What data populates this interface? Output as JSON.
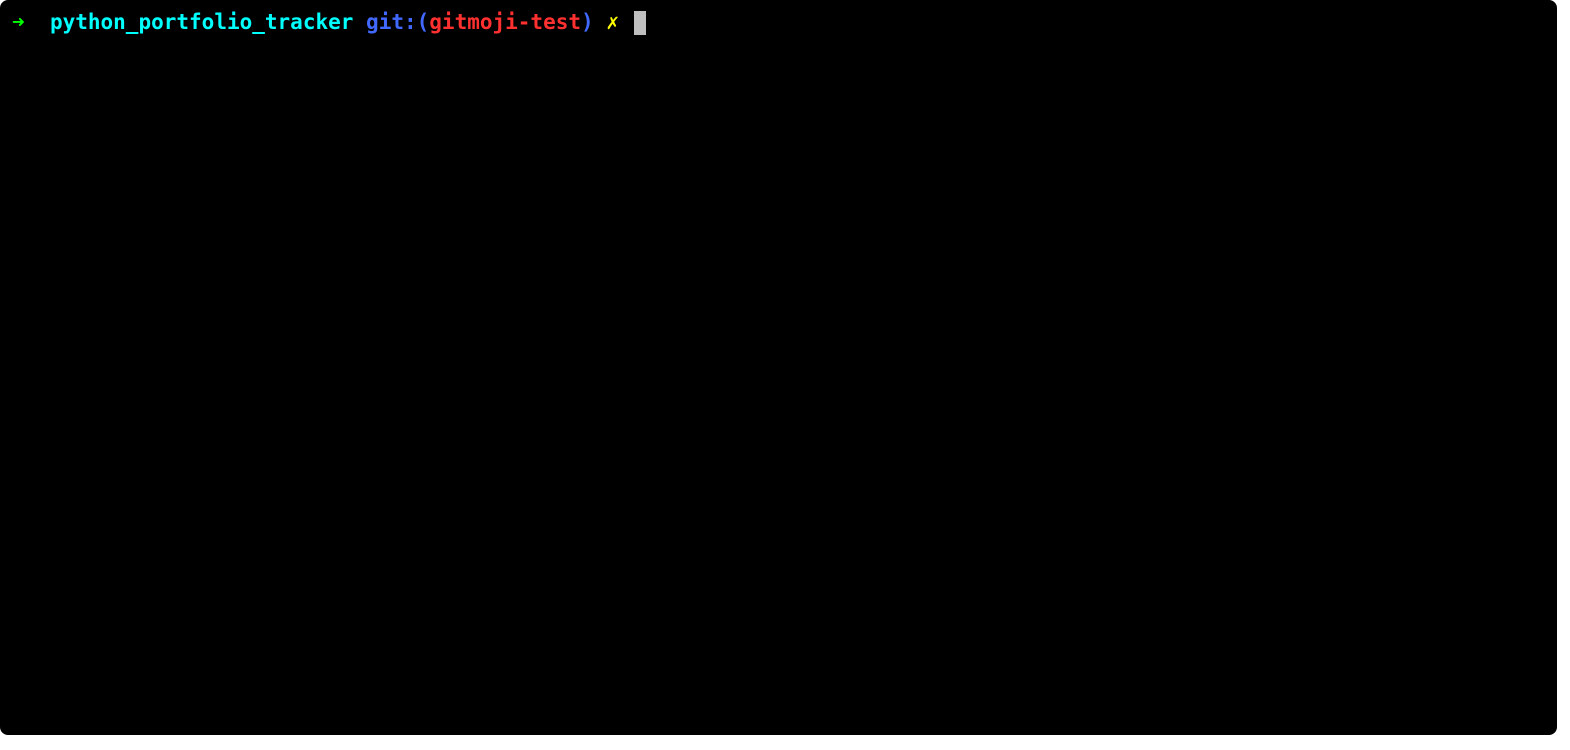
{
  "prompt": {
    "arrow": "➜",
    "cwd": "python_portfolio_tracker",
    "git_label": "git:",
    "git_paren_open": "(",
    "git_branch": "gitmoji-test",
    "git_paren_close": ")",
    "dirty_marker": "✗"
  },
  "colors": {
    "arrow": "#00ff00",
    "cwd": "#00ffff",
    "git_label": "#4169ff",
    "git_branch": "#ff3030",
    "dirty": "#ffff00",
    "cursor": "#bfbfbf",
    "background": "#000000"
  }
}
